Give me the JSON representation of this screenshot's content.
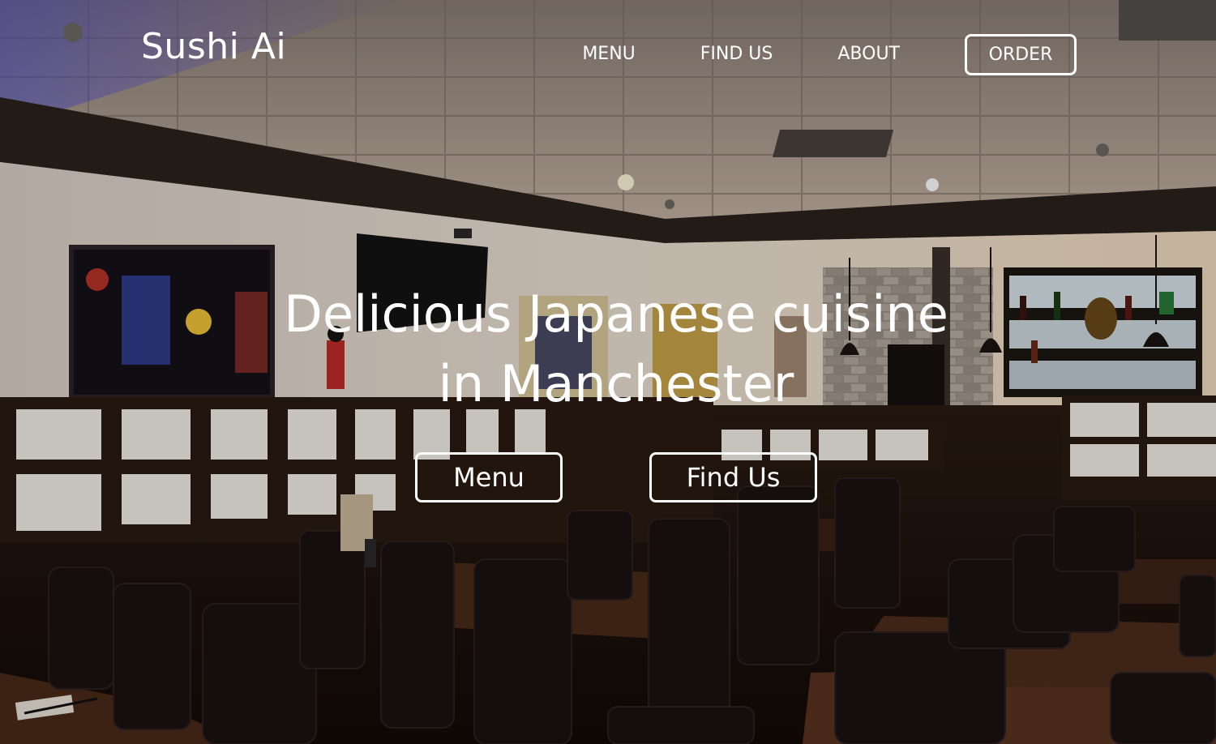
{
  "brand": {
    "name": "Sushi Ai"
  },
  "nav": {
    "items": [
      {
        "label": "MENU"
      },
      {
        "label": "FIND US"
      },
      {
        "label": "ABOUT"
      }
    ],
    "order_label": "ORDER"
  },
  "hero": {
    "headline_line1": "Delicious Japanese cuisine",
    "headline_line2": "in Manchester",
    "buttons": {
      "menu_label": "Menu",
      "find_label": "Find Us"
    }
  },
  "colors": {
    "text": "#ffffff",
    "wall": "#e8ddd0",
    "wood": "#4a2a1a",
    "ceiling": "#b8a89c",
    "accent_blue": "#3a3fd8"
  }
}
